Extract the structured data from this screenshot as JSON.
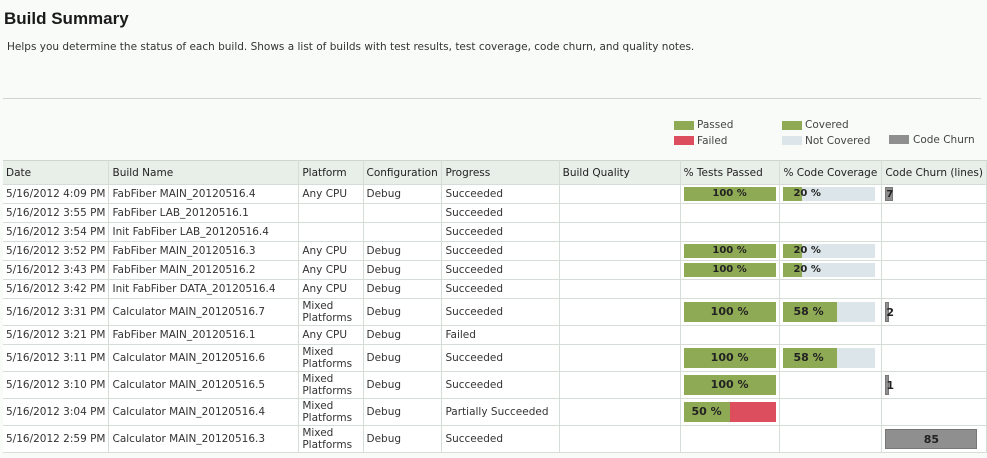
{
  "page": {
    "title": "Build Summary",
    "description": "Helps you determine the status of each build. Shows a list of builds with test results, test coverage, code churn, and quality notes."
  },
  "legend": {
    "passed": "Passed",
    "failed": "Failed",
    "covered": "Covered",
    "not_covered": "Not Covered",
    "code_churn": "Code Churn"
  },
  "colors": {
    "passed": "#8faa55",
    "failed": "#dc4e5e",
    "covered": "#8faa55",
    "not_covered": "#dce6ea",
    "churn": "#8f8f8f"
  },
  "table": {
    "columns": [
      "Date",
      "Build Name",
      "Platform",
      "Configuration",
      "Progress",
      "Build Quality",
      "% Tests Passed",
      "% Code Coverage",
      "Code Churn (lines)"
    ],
    "rows": [
      {
        "date": "5/16/2012 4:09 PM",
        "name": "FabFiber MAIN_20120516.4",
        "platform": "Any CPU",
        "config": "Debug",
        "progress": "Succeeded",
        "quality": "",
        "tests_passed": 100,
        "tests_label": "100 %",
        "coverage": 20,
        "coverage_label": "20 %",
        "churn": 7,
        "churn_label": "7",
        "tall": false
      },
      {
        "date": "5/16/2012 3:55 PM",
        "name": "FabFiber LAB_20120516.1",
        "platform": "",
        "config": "",
        "progress": "Succeeded",
        "quality": "",
        "tests_passed": null,
        "tests_label": "",
        "coverage": null,
        "coverage_label": "",
        "churn": null,
        "churn_label": "",
        "tall": false
      },
      {
        "date": "5/16/2012 3:54 PM",
        "name": "Init FabFiber LAB_20120516.4",
        "platform": "",
        "config": "",
        "progress": "Succeeded",
        "quality": "",
        "tests_passed": null,
        "tests_label": "",
        "coverage": null,
        "coverage_label": "",
        "churn": null,
        "churn_label": "",
        "tall": false
      },
      {
        "date": "5/16/2012 3:52 PM",
        "name": "FabFiber MAIN_20120516.3",
        "platform": "Any CPU",
        "config": "Debug",
        "progress": "Succeeded",
        "quality": "",
        "tests_passed": 100,
        "tests_label": "100 %",
        "coverage": 20,
        "coverage_label": "20 %",
        "churn": null,
        "churn_label": "",
        "tall": false
      },
      {
        "date": "5/16/2012 3:43 PM",
        "name": "FabFiber MAIN_20120516.2",
        "platform": "Any CPU",
        "config": "Debug",
        "progress": "Succeeded",
        "quality": "",
        "tests_passed": 100,
        "tests_label": "100 %",
        "coverage": 20,
        "coverage_label": "20 %",
        "churn": null,
        "churn_label": "",
        "tall": false
      },
      {
        "date": "5/16/2012 3:42 PM",
        "name": "Init FabFiber DATA_20120516.4",
        "platform": "Any CPU",
        "config": "Debug",
        "progress": "Succeeded",
        "quality": "",
        "tests_passed": null,
        "tests_label": "",
        "coverage": null,
        "coverage_label": "",
        "churn": null,
        "churn_label": "",
        "tall": false
      },
      {
        "date": "5/16/2012 3:31 PM",
        "name": "Calculator MAIN_20120516.7",
        "platform": "Mixed Platforms",
        "config": "Debug",
        "progress": "Succeeded",
        "quality": "",
        "tests_passed": 100,
        "tests_label": "100 %",
        "coverage": 58,
        "coverage_label": "58 %",
        "churn": 2,
        "churn_label": "2",
        "tall": true
      },
      {
        "date": "5/16/2012 3:21 PM",
        "name": "FabFiber MAIN_20120516.1",
        "platform": "Any CPU",
        "config": "Debug",
        "progress": "Failed",
        "quality": "",
        "tests_passed": null,
        "tests_label": "",
        "coverage": null,
        "coverage_label": "",
        "churn": null,
        "churn_label": "",
        "tall": false
      },
      {
        "date": "5/16/2012 3:11 PM",
        "name": "Calculator MAIN_20120516.6",
        "platform": "Mixed Platforms",
        "config": "Debug",
        "progress": "Succeeded",
        "quality": "",
        "tests_passed": 100,
        "tests_label": "100 %",
        "coverage": 58,
        "coverage_label": "58 %",
        "churn": null,
        "churn_label": "",
        "tall": true
      },
      {
        "date": "5/16/2012 3:10 PM",
        "name": "Calculator MAIN_20120516.5",
        "platform": "Mixed Platforms",
        "config": "Debug",
        "progress": "Succeeded",
        "quality": "",
        "tests_passed": 100,
        "tests_label": "100 %",
        "coverage": null,
        "coverage_label": "",
        "churn": 1,
        "churn_label": "1",
        "tall": true
      },
      {
        "date": "5/16/2012 3:04 PM",
        "name": "Calculator MAIN_20120516.4",
        "platform": "Mixed Platforms",
        "config": "Debug",
        "progress": "Partially Succeeded",
        "quality": "",
        "tests_passed": 50,
        "tests_label": "50 %",
        "coverage": null,
        "coverage_label": "",
        "churn": null,
        "churn_label": "",
        "tall": true
      },
      {
        "date": "5/16/2012 2:59 PM",
        "name": "Calculator MAIN_20120516.3",
        "platform": "Mixed Platforms",
        "config": "Debug",
        "progress": "Succeeded",
        "quality": "",
        "tests_passed": null,
        "tests_label": "",
        "coverage": null,
        "coverage_label": "",
        "churn": 85,
        "churn_label": "85",
        "tall": true
      }
    ]
  }
}
